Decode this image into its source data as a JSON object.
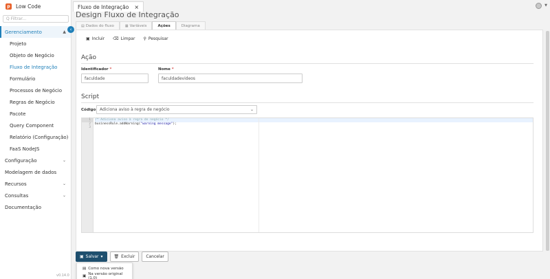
{
  "app": {
    "name": "Low Code",
    "logo_letter": "p",
    "version": "v0.14.0"
  },
  "sidebar": {
    "search_placeholder": "Q Filtrar...",
    "groups": [
      {
        "label": "Gerenciamento",
        "expanded": true,
        "items": [
          "Projeto",
          "Objeto de Negócio",
          "Fluxo de Integração",
          "Formulário",
          "Processos de Negócio",
          "Regras de Negócio",
          "Pacote",
          "Query Component",
          "Relatório (Configuração)",
          "FaaS NodeJS"
        ]
      },
      {
        "label": "Configuração"
      },
      {
        "label": "Modelagem de dados"
      },
      {
        "label": "Recursos"
      },
      {
        "label": "Consultas"
      },
      {
        "label": "Documentação"
      }
    ],
    "active_item": "Fluxo de Integração"
  },
  "topbar": {
    "doc_tab": "Fluxo de Integração",
    "close": "×"
  },
  "page": {
    "title": "Design Fluxo de Integração",
    "tabs": [
      "Dados do fluxo",
      "Variáveis",
      "Ações",
      "Diagrama"
    ],
    "active_tab": "Ações"
  },
  "toolbar": {
    "incluir": "Incluir",
    "limpar": "Limpar",
    "pesquisar": "Pesquisar"
  },
  "acao": {
    "title": "Ação",
    "identificador_label": "Identificador",
    "identificador_value": "faculdade",
    "nome_label": "Nome",
    "nome_value": "faculdadevideos",
    "required_mark": "*"
  },
  "script": {
    "title": "Script",
    "codigo_label": "Código",
    "codigo_value": "Adiciona aviso à regra de negócio",
    "line_numbers": [
      "1",
      "2",
      "3"
    ],
    "line1": "/* Adiciona aviso à regra de negócio */",
    "line2_pre": "businessRule.addWarning(",
    "line2_str": "\"warning message\"",
    "line2_post": ");",
    "line3": ""
  },
  "actions": {
    "salvar": "Salvar",
    "excluir": "Excluir",
    "cancelar": "Cancelar",
    "dropdown": [
      "Como nova versão",
      "Na versão original (1.0)"
    ]
  },
  "colors": {
    "accent": "#1f7fb8",
    "primary_button": "#1e4f6e",
    "brand": "#e8622c",
    "required": "#d9534f"
  }
}
